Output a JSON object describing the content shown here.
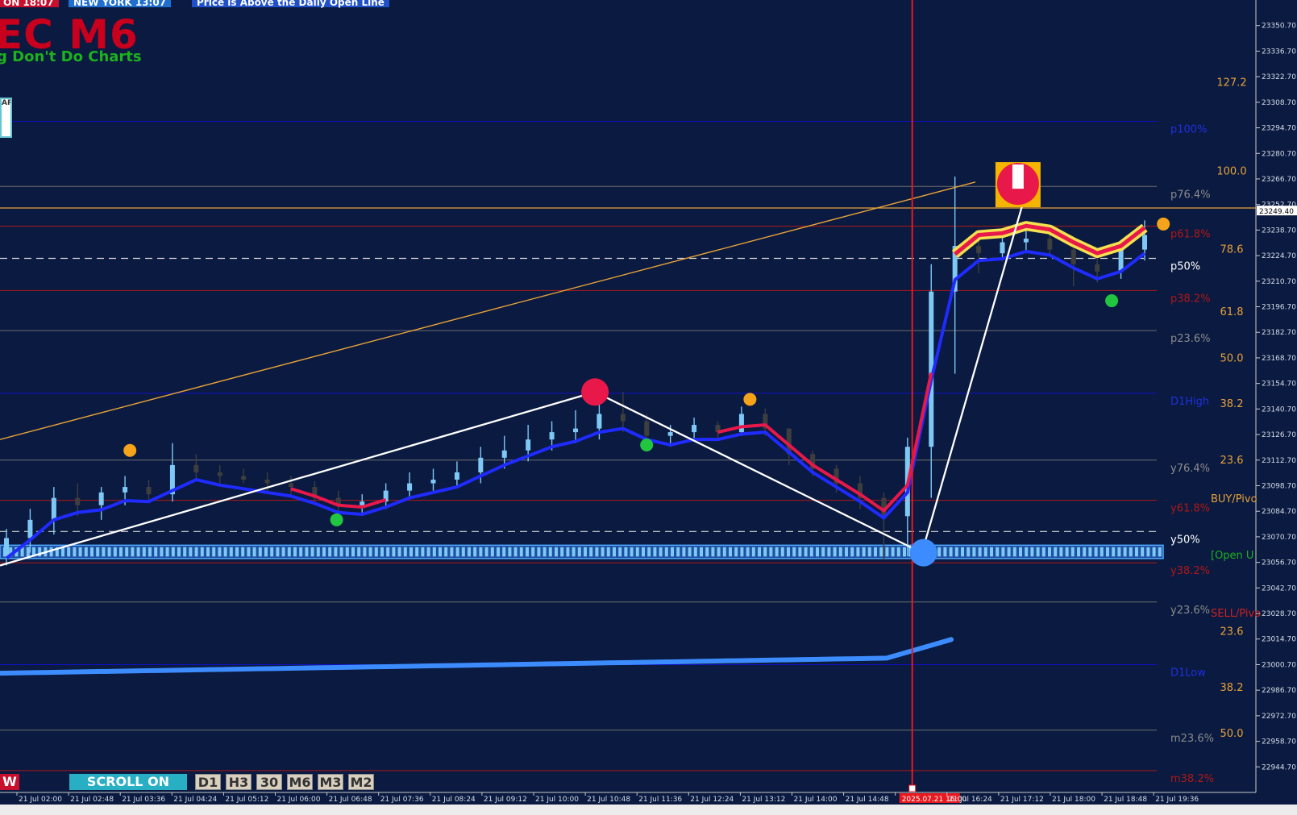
{
  "header": {
    "badges": [
      {
        "text": "ON  18:07",
        "bg": "#C8102E"
      },
      {
        "text": "NEW YORK  13:07",
        "bg": "#1F6FD1"
      },
      {
        "text": "Price is Above the Daily Open Line",
        "bg": "#2050C8"
      }
    ],
    "title": "EC M6",
    "subtitle": "g Don't Do Charts",
    "logo_text": "AP"
  },
  "toolbar": {
    "w_label": "W",
    "scroll_label": "SCROLL ON",
    "timeframes": [
      "D1",
      "H3",
      "30",
      "M6",
      "M3",
      "M2"
    ]
  },
  "colors": {
    "background": "#0A1A40",
    "axis_bg": "#0A1A40",
    "bull_candle": "#7EC8F5",
    "bear_candle": "#3E3E3E",
    "ma_blue": "#1F2BFF",
    "ma_red": "#E8184A",
    "slow_ma": "#3C8CFF",
    "fib_orange": "#E8A23A",
    "vline": "#E8181E"
  },
  "chart_data": {
    "type": "candlestick",
    "symbol_hint": "M6",
    "ylim": [
      22930.7,
      23364.7
    ],
    "current_price": "23249.40",
    "y_ticks": [
      "23350.70",
      "23336.70",
      "23322.70",
      "23308.70",
      "23294.70",
      "23280.70",
      "23266.70",
      "23252.70",
      "23238.70",
      "23224.70",
      "23210.70",
      "23196.70",
      "23182.70",
      "23168.70",
      "23154.70",
      "23140.70",
      "23126.70",
      "23112.70",
      "23098.70",
      "23084.70",
      "23070.70",
      "23056.70",
      "23042.70",
      "23028.70",
      "23014.70",
      "23000.70",
      "22986.70",
      "22972.70",
      "22958.70",
      "22944.70"
    ],
    "x_ticks": [
      "21 Jul 02:00",
      "21 Jul 02:48",
      "21 Jul 03:36",
      "21 Jul 04:24",
      "21 Jul 05:12",
      "21 Jul 06:00",
      "21 Jul 06:48",
      "21 Jul 07:36",
      "21 Jul 08:24",
      "21 Jul 09:12",
      "21 Jul 10:00",
      "21 Jul 10:48",
      "21 Jul 11:36",
      "21 Jul 12:24",
      "21 Jul 13:12",
      "21 Jul 14:00",
      "21 Jul 14:48",
      "2025.07.21 16:00",
      "21 Jul 16:24",
      "21 Jul 17:12",
      "21 Jul 18:00",
      "21 Jul 18:48",
      "21 Jul 19:36"
    ],
    "marker_time_label": "2025.07.21 16:00",
    "pivot_levels": [
      {
        "label": "p100%",
        "value": 23298.2,
        "color": "#2030E0",
        "line": "#1010C8"
      },
      {
        "label": "p76.4%",
        "value": 23262.6,
        "color": "#8C8C8C",
        "line": "#6E6E6E"
      },
      {
        "label": "p61.8%",
        "value": 23240.8,
        "color": "#B01818",
        "line": "#B01818"
      },
      {
        "label": "p50%",
        "value": 23223.2,
        "color": "#FFFFFF",
        "line": "dash"
      },
      {
        "label": "p38.2%",
        "value": 23205.6,
        "color": "#B01818",
        "line": "#B01818"
      },
      {
        "label": "p23.6%",
        "value": 23183.6,
        "color": "#8C8C8C",
        "line": "#6E6E6E"
      },
      {
        "label": "D1High",
        "value": 23149.3,
        "color": "#2030E0",
        "line": "#1010C8"
      },
      {
        "label": "y76.4%",
        "value": 23112.7,
        "color": "#8C8C8C",
        "line": "#6E6E6E"
      },
      {
        "label": "y61.8%",
        "value": 23090.7,
        "color": "#B01818",
        "line": "#B01818"
      },
      {
        "label": "y50%",
        "value": 23073.6,
        "color": "#FFFFFF",
        "line": "dash"
      },
      {
        "label": "y38.2%",
        "value": 23056.5,
        "color": "#B01818",
        "line": "#B01818"
      },
      {
        "label": "y23.6%",
        "value": 23035.0,
        "color": "#8C8C8C",
        "line": "#6E6E6E"
      },
      {
        "label": "D1Low",
        "value": 23000.7,
        "color": "#2030E0",
        "line": "#1010C8"
      },
      {
        "label": "m23.6%",
        "value": 22964.8,
        "color": "#8C8C8C",
        "line": "#6E6E6E"
      },
      {
        "label": "m38.2%",
        "value": 22942.7,
        "color": "#B01818",
        "line": "#B01818"
      }
    ],
    "fib_right_labels": [
      {
        "label": "127.2",
        "value": 23319.8
      },
      {
        "label": "100.0",
        "value": 23271.3
      },
      {
        "label": "78.6",
        "value": 23228.5
      },
      {
        "label": "61.8",
        "value": 23194.2
      },
      {
        "label": "50.0",
        "value": 23169.0
      },
      {
        "label": "38.2",
        "value": 23143.9
      },
      {
        "label": "23.6",
        "value": 23113.1
      },
      {
        "label": "23.6",
        "value": 23019.2
      },
      {
        "label": "38.2",
        "value": 22988.6
      },
      {
        "label": "50.0",
        "value": 22963.4
      }
    ],
    "side_texts": [
      {
        "text": "BUY/Pivo",
        "value": 23091.8,
        "color": "#E8A23A"
      },
      {
        "text": "[Open U",
        "value": 23061.0,
        "color": "#1DB11D"
      },
      {
        "text": "SELL/Pivo",
        "value": 23029.2,
        "color": "#D02020"
      }
    ],
    "daily_open_band": [
      23058.8,
      23066.1
    ],
    "orange_level": 23250.8,
    "candles": [
      [
        23060,
        23075,
        23055,
        23070
      ],
      [
        23070,
        23086,
        23062,
        23080
      ],
      [
        23080,
        23098,
        23072,
        23092
      ],
      [
        23092,
        23100,
        23082,
        23088
      ],
      [
        23088,
        23098,
        23080,
        23095
      ],
      [
        23095,
        23104,
        23088,
        23098
      ],
      [
        23098,
        23102,
        23090,
        23094
      ],
      [
        23094,
        23122,
        23090,
        23110
      ],
      [
        23110,
        23116,
        23102,
        23106
      ],
      [
        23106,
        23110,
        23100,
        23104
      ],
      [
        23104,
        23108,
        23100,
        23102
      ],
      [
        23102,
        23106,
        23096,
        23100
      ],
      [
        23100,
        23104,
        23094,
        23098
      ],
      [
        23098,
        23101,
        23088,
        23092
      ],
      [
        23092,
        23096,
        23082,
        23088
      ],
      [
        23088,
        23094,
        23084,
        23090
      ],
      [
        23090,
        23100,
        23086,
        23096
      ],
      [
        23096,
        23106,
        23092,
        23100
      ],
      [
        23100,
        23108,
        23096,
        23102
      ],
      [
        23102,
        23112,
        23098,
        23106
      ],
      [
        23106,
        23120,
        23100,
        23114
      ],
      [
        23114,
        23126,
        23108,
        23118
      ],
      [
        23118,
        23132,
        23112,
        23124
      ],
      [
        23124,
        23134,
        23118,
        23128
      ],
      [
        23128,
        23140,
        23122,
        23130
      ],
      [
        23130,
        23146,
        23124,
        23138
      ],
      [
        23138,
        23150,
        23128,
        23134
      ],
      [
        23134,
        23138,
        23122,
        23126
      ],
      [
        23126,
        23132,
        23120,
        23128
      ],
      [
        23128,
        23136,
        23124,
        23132
      ],
      [
        23132,
        23134,
        23124,
        23128
      ],
      [
        23128,
        23142,
        23126,
        23138
      ],
      [
        23138,
        23141,
        23126,
        23130
      ],
      [
        23130,
        23130,
        23110,
        23116
      ],
      [
        23116,
        23118,
        23104,
        23108
      ],
      [
        23108,
        23110,
        23095,
        23100
      ],
      [
        23100,
        23104,
        23086,
        23092
      ],
      [
        23092,
        23095,
        23058,
        23082
      ],
      [
        23082,
        23125,
        23060,
        23120
      ],
      [
        23120,
        23220,
        23092,
        23205
      ],
      [
        23205,
        23268,
        23160,
        23230
      ],
      [
        23230,
        23238,
        23215,
        23226
      ],
      [
        23226,
        23236,
        23222,
        23232
      ],
      [
        23232,
        23240,
        23226,
        23234
      ],
      [
        23234,
        23238,
        23224,
        23228
      ],
      [
        23228,
        23232,
        23208,
        23220
      ],
      [
        23220,
        23224,
        23210,
        23216
      ],
      [
        23216,
        23230,
        23212,
        23228
      ],
      [
        23228,
        23244,
        23222,
        23236
      ]
    ],
    "markers": [
      {
        "type": "dot",
        "color": "#F5A31A",
        "value": 23118,
        "tick": "21 Jul 03:36"
      },
      {
        "type": "dot",
        "color": "#22C540",
        "value": 23080,
        "tick": "21 Jul 06:48"
      },
      {
        "type": "dot",
        "color": "#E8184A",
        "value": 23150,
        "tick": "21 Jul 10:48"
      },
      {
        "type": "dot",
        "color": "#22C540",
        "value": 23121,
        "tick": "21 Jul 11:36"
      },
      {
        "type": "dot",
        "color": "#F5A31A",
        "value": 23146,
        "tick": "21 Jul 13:12"
      },
      {
        "type": "dot",
        "color": "#3C8CFF",
        "value": 23062,
        "tick": "2025.07.21 16:00"
      },
      {
        "type": "dot",
        "color": "#F5A31A",
        "value": 23242,
        "tick": "21 Jul 19:36"
      },
      {
        "type": "dot",
        "color": "#22C540",
        "value": 23200,
        "tick": "21 Jul 18:48"
      },
      {
        "type": "flag",
        "color": "#E8184A",
        "value": 23264,
        "tick": "21 Jul 17:12"
      }
    ],
    "zigzag": [
      23055.0,
      23150.0,
      23062.0,
      23264.0
    ],
    "grid": false
  }
}
